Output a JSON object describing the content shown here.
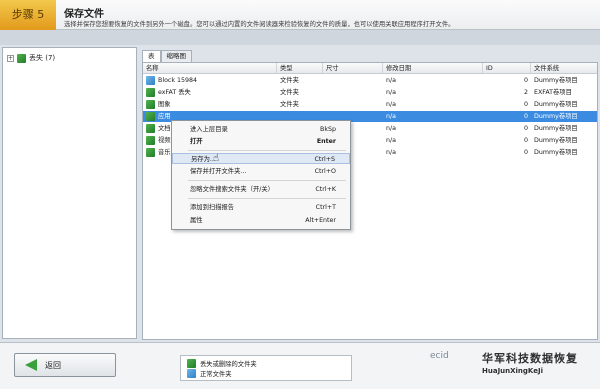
{
  "header": {
    "step": "步骤 5",
    "title": "保存文件",
    "description": "选择并保存您想要恢复的文件到另外一个磁盘。您可以通过内置的文件阅读器来检验恢复的文件的质量，也可以使用关联应用程序打开文件。"
  },
  "tree": {
    "expander": "+",
    "root_label": "丢失 (7)"
  },
  "tabs": [
    "表",
    "缩略图"
  ],
  "columns": [
    "名称",
    "类型",
    "尺寸",
    "修改日期",
    "ID",
    "文件系统"
  ],
  "rows": [
    {
      "name": "Block 15984",
      "type": "文件夹",
      "size": "",
      "date": "n/a",
      "id": "0",
      "fs": "Dummy卷项目",
      "icon": "blue"
    },
    {
      "name": "exFAT 丢失",
      "type": "文件夹",
      "size": "",
      "date": "n/a",
      "id": "2",
      "fs": "EXFAT卷项目",
      "icon": "green"
    },
    {
      "name": "图象",
      "type": "文件夹",
      "size": "",
      "date": "n/a",
      "id": "0",
      "fs": "Dummy卷项目",
      "icon": "green"
    },
    {
      "name": "应用",
      "type": "",
      "size": "",
      "date": "n/a",
      "id": "0",
      "fs": "Dummy卷项目",
      "icon": "green"
    },
    {
      "name": "文档",
      "type": "",
      "size": "",
      "date": "n/a",
      "id": "0",
      "fs": "Dummy卷项目",
      "icon": "green"
    },
    {
      "name": "视频",
      "type": "",
      "size": "",
      "date": "n/a",
      "id": "0",
      "fs": "Dummy卷项目",
      "icon": "green"
    },
    {
      "name": "音乐",
      "type": "",
      "size": "",
      "date": "n/a",
      "id": "0",
      "fs": "Dummy卷项目",
      "icon": "green"
    }
  ],
  "context_menu": [
    {
      "label": "进入上层目录",
      "key": "BkSp"
    },
    {
      "label": "打开",
      "key": "Enter"
    },
    {
      "label": "另存为...",
      "key": "Ctrl+S"
    },
    {
      "label": "保存并打开文件夹...",
      "key": "Ctrl+O"
    },
    {
      "label": "忽略文件搜索文件夹（开/关）",
      "key": "Ctrl+K"
    },
    {
      "label": "添加到扫描报告",
      "key": "Ctrl+T"
    },
    {
      "label": "属性",
      "key": "Alt+Enter"
    }
  ],
  "footer": {
    "back_label": "返回",
    "legend": [
      "丢失或删除的文件夹",
      "正常文件夹"
    ],
    "watermark": "ecid",
    "watermark_cn": "华军科技数据恢复",
    "watermark_en": "HuaJunXingKeJi"
  },
  "colors": {
    "accent": "#3b8be0",
    "step_badge": "#e9ae2f",
    "folder_green": "#2f9a38"
  }
}
